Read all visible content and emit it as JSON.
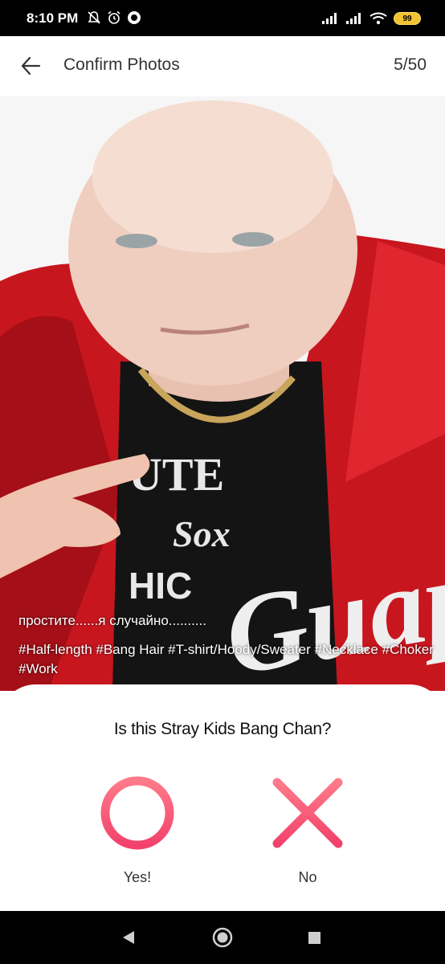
{
  "status_bar": {
    "time": "8:10 PM",
    "battery": "99",
    "icons": [
      "mute-bell-icon",
      "alarm-icon",
      "app-notification-icon",
      "signal-icon",
      "signal-icon",
      "wifi-icon"
    ]
  },
  "header": {
    "title": "Confirm Photos",
    "counter": "5/50"
  },
  "photo": {
    "caption": "простите......я случайно..........",
    "tags": "#Half-length #Bang Hair #T-shirt/Hoody/Sweater #Necklace #Choker #Work",
    "jacket_color": "#c8161f",
    "shirt_color": "#141414"
  },
  "prompt": {
    "question": "Is this Stray Kids Bang Chan?",
    "yes_label": "Yes!",
    "no_label": "No",
    "accent_start": "#ff7a8a",
    "accent_end": "#f2426b"
  },
  "nav_bar": {
    "icons": [
      "back-triangle-icon",
      "home-circle-icon",
      "recents-square-icon"
    ]
  }
}
